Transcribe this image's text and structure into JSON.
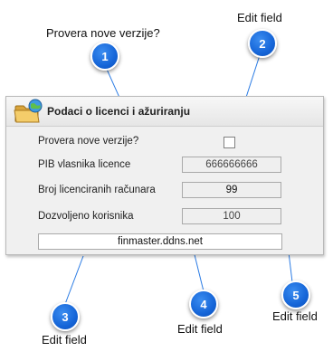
{
  "callouts": [
    {
      "number": "1",
      "caption": "Provera nove verzije?"
    },
    {
      "number": "2",
      "caption": "Edit field"
    },
    {
      "number": "3",
      "caption": "Edit field"
    },
    {
      "number": "4",
      "caption": "Edit field"
    },
    {
      "number": "5",
      "caption": "Edit field"
    }
  ],
  "panel": {
    "title": "Podaci o licenci i ažuriranju",
    "icon": "folder-globe-icon",
    "check_update": {
      "label": "Provera nove verzije?",
      "checked": false
    },
    "pib": {
      "label": "PIB vlasnika licence",
      "value": "666666666"
    },
    "licensed_computers": {
      "label": "Broj licenciranih računara",
      "value": "99"
    },
    "allowed_users": {
      "label": "Dozvoljeno korisnika",
      "value": "100"
    },
    "server_url": {
      "value": "finmaster.ddns.net"
    }
  },
  "colors": {
    "badge": "#1565d8",
    "leader_line": "#2a7be4",
    "panel_background": "#f0f0f0"
  }
}
